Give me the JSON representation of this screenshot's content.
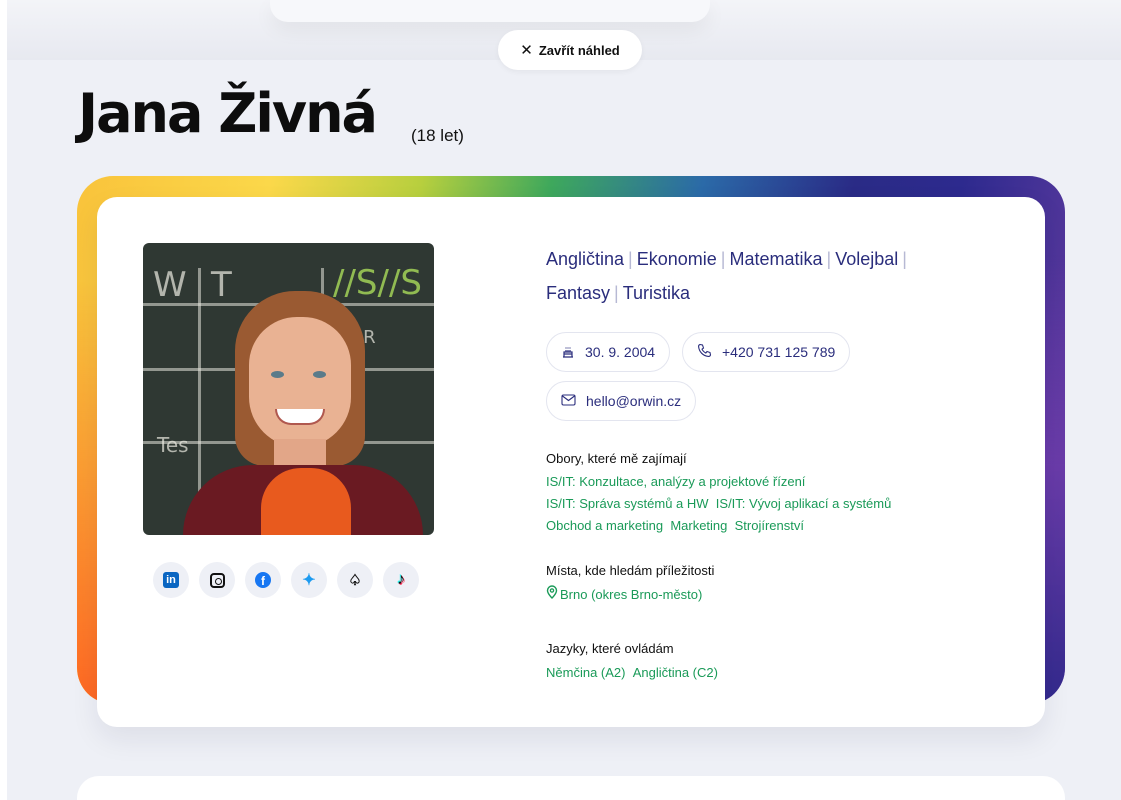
{
  "header": {
    "close_label": "Zavřít náhled",
    "close_icon": "✕"
  },
  "profile": {
    "name": "Jana Živná",
    "age": "(18 let)",
    "interests": [
      "Angličtina",
      "Ekonomie",
      "Matematika",
      "Volejbal",
      "Fantasy",
      "Turistika"
    ],
    "birthday": "30. 9. 2004",
    "phone": "+420 731 125 789",
    "email": "hello@orwin.cz",
    "fields_label": "Obory, které mě zajímají",
    "fields": [
      [
        "IS/IT: Konzultace, analýzy a projektové řízení"
      ],
      [
        "IS/IT: Správa systémů a HW",
        "IS/IT: Vývoj aplikací a systémů"
      ],
      [
        "Obchod a marketing",
        "Marketing",
        "Strojírenství"
      ]
    ],
    "places_label": "Místa, kde hledám příležitosti",
    "place": "Brno (okres Brno-město)",
    "languages_label": "Jazyky, které ovládám",
    "languages": [
      "Němčina (A2)",
      "Angličtina (C2)"
    ]
  },
  "socials": [
    "linkedin-icon",
    "instagram-icon",
    "facebook-icon",
    "twitter-icon",
    "snapchat-icon",
    "tiktok-icon"
  ],
  "colors": {
    "accent_navy": "#2a2d7c",
    "accent_green": "#1a9a58",
    "background": "#eef0f6"
  }
}
